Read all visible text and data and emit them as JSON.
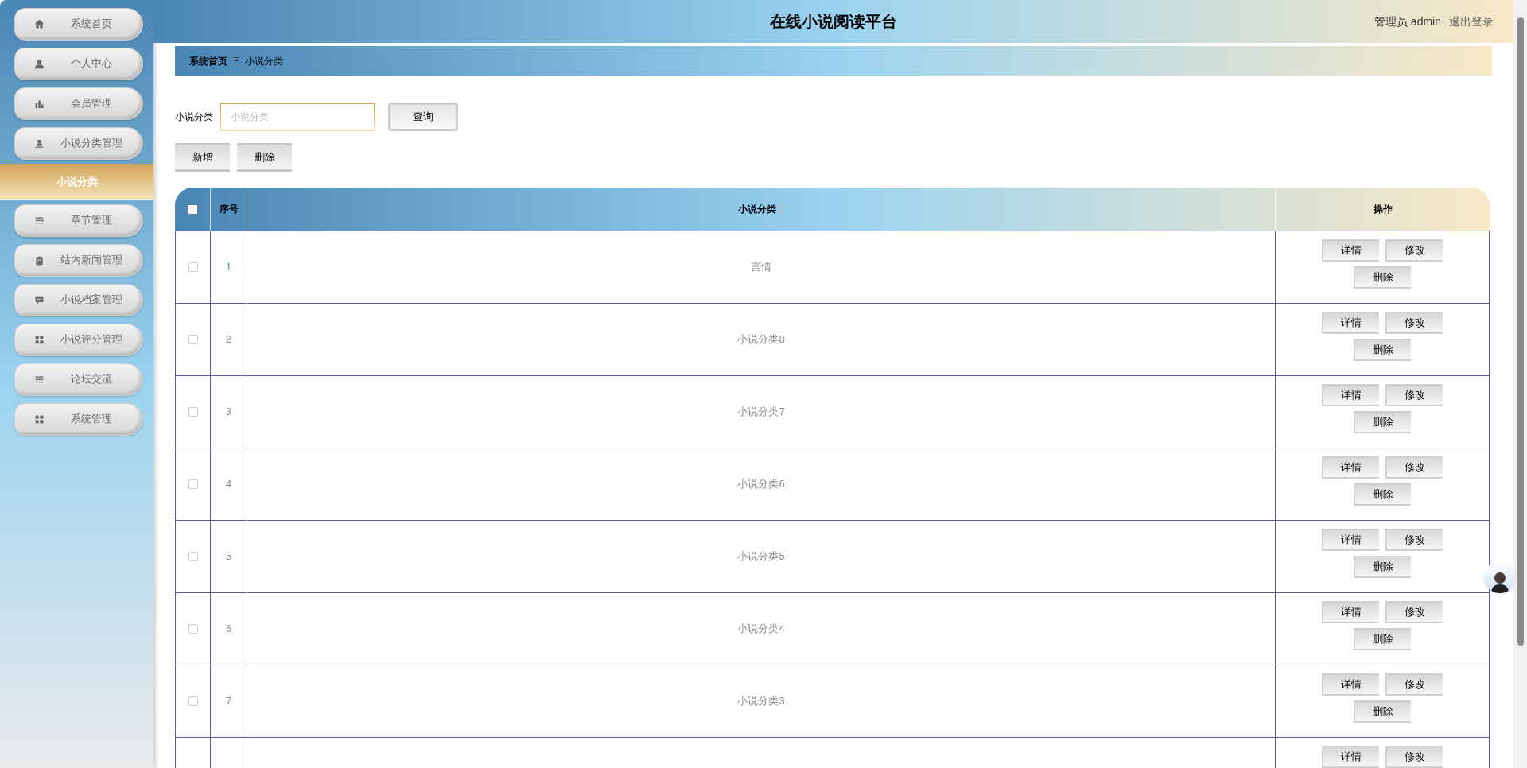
{
  "header": {
    "title": "在线小说阅读平台",
    "user": "管理员 admin",
    "logout": "退出登录"
  },
  "sidebar": {
    "items": [
      {
        "label": "系统首页"
      },
      {
        "label": "个人中心"
      },
      {
        "label": "会员管理"
      },
      {
        "label": "小说分类管理",
        "expanded": true,
        "children": [
          {
            "label": "小说分类",
            "selected": true
          }
        ]
      },
      {
        "label": "章节管理"
      },
      {
        "label": "站内新闻管理"
      },
      {
        "label": "小说档案管理"
      },
      {
        "label": "小说评分管理"
      },
      {
        "label": "论坛交流"
      },
      {
        "label": "系统管理"
      }
    ]
  },
  "breadcrumb": [
    {
      "label": "系统首页"
    },
    {
      "label": "小说分类"
    }
  ],
  "breadcrumb_separator": "Ξ",
  "search": {
    "label": "小说分类",
    "placeholder": "小说分类",
    "button": "查询"
  },
  "actions": [
    "新增",
    "删除"
  ],
  "table": {
    "select_all_checked": false,
    "columns": [
      "序号",
      "小说分类",
      "操作"
    ],
    "rows": [
      {
        "index": "1",
        "name": "言情",
        "highlighted": true,
        "checked": false,
        "actions": [
          "详情",
          "修改",
          "删除"
        ]
      },
      {
        "index": "2",
        "name": "小说分类8",
        "highlighted": false,
        "checked": false,
        "actions": [
          "详情",
          "修改",
          "删除"
        ]
      },
      {
        "index": "3",
        "name": "小说分类7",
        "highlighted": false,
        "checked": false,
        "actions": [
          "详情",
          "修改",
          "删除"
        ]
      },
      {
        "index": "4",
        "name": "小说分类6",
        "highlighted": false,
        "checked": false,
        "actions": [
          "详情",
          "修改",
          "删除"
        ]
      },
      {
        "index": "5",
        "name": "小说分类5",
        "highlighted": false,
        "checked": false,
        "actions": [
          "详情",
          "修改",
          "删除"
        ]
      },
      {
        "index": "6",
        "name": "小说分类4",
        "highlighted": false,
        "checked": false,
        "actions": [
          "详情",
          "修改",
          "删除"
        ]
      },
      {
        "index": "7",
        "name": "小说分类3",
        "highlighted": false,
        "checked": false,
        "actions": [
          "详情",
          "修改",
          "删除"
        ]
      },
      {
        "actions": [
          "详情",
          "修改"
        ]
      }
    ]
  }
}
